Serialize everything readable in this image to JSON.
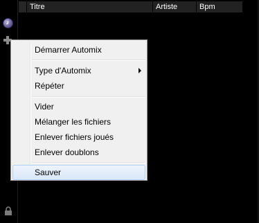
{
  "header": {
    "col_titre": "Titre",
    "col_artiste": "Artiste",
    "col_bpm": "Bpm"
  },
  "menu": {
    "items": [
      {
        "label": "Démarrer Automix"
      },
      {
        "label": "Type d'Automix",
        "submenu": true
      },
      {
        "label": "Répéter"
      },
      {
        "label": "Vider"
      },
      {
        "label": "Mélanger les fichiers"
      },
      {
        "label": "Enlever fichiers joués"
      },
      {
        "label": "Enlever doublons"
      },
      {
        "label": "Sauver",
        "highlighted": true
      }
    ]
  },
  "icons": {
    "clock": "clock-icon",
    "plus": "plus-icon",
    "lock": "lock-icon"
  },
  "colors": {
    "menu_bg": "#f0f0f0",
    "highlight_border": "#aecff7",
    "header_bg": "#222222"
  }
}
